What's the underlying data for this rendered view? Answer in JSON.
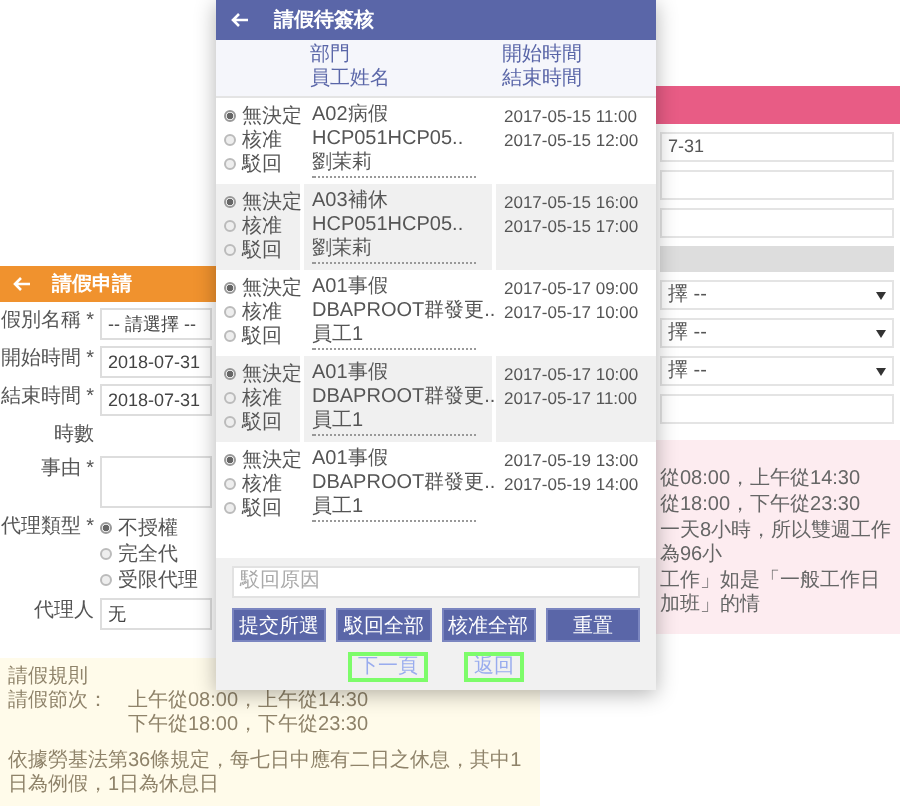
{
  "request_form": {
    "title": "請假申請",
    "fields": [
      {
        "kind": "select",
        "label": "假別名稱 *",
        "value": "-- 請選擇 --"
      },
      {
        "kind": "input",
        "label": "開始時間 *",
        "value": "2018-07-31"
      },
      {
        "kind": "input",
        "label": "結束時間 *",
        "value": "2018-07-31"
      },
      {
        "kind": "text",
        "label": "時數"
      },
      {
        "kind": "textarea",
        "label": "事由 *"
      },
      {
        "kind": "radio",
        "label": "代理類型 *",
        "options": [
          {
            "label": "不授權",
            "selected": true
          },
          {
            "label": "完全代",
            "selected": false
          },
          {
            "label": "受限代理",
            "selected": false
          }
        ]
      },
      {
        "kind": "input",
        "label": "代理人",
        "value": "无"
      }
    ],
    "rules": {
      "title": "請假規則",
      "label": "請假節次：",
      "lines": [
        "上午從08:00，上午從14:30",
        "下午從18:00，下午從23:30"
      ],
      "note": "依據勞基法第36條規定，每七日中應有二日之休息，其中1日為例假，1日為休息日"
    }
  },
  "approval_list": {
    "title": "請假待簽核",
    "columns": [
      {
        "line1": "部門",
        "line2": "員工姓名"
      },
      {
        "line1": "開始時間",
        "line2": "結束時間"
      }
    ],
    "rows": [
      {
        "options": [
          {
            "label": "無決定",
            "selected": true
          },
          {
            "label": "核准",
            "selected": false
          },
          {
            "label": "駁回",
            "selected": false
          }
        ],
        "leave_type": "A02病假",
        "department": "HCP051HCP05..",
        "employee": "劉茉莉",
        "start": "2017-05-15 11:00",
        "end": "2017-05-15 12:00"
      },
      {
        "options": [
          {
            "label": "無決定",
            "selected": true
          },
          {
            "label": "核准",
            "selected": false
          },
          {
            "label": "駁回",
            "selected": false
          }
        ],
        "leave_type": "A03補休",
        "department": "HCP051HCP05..",
        "employee": "劉茉莉",
        "start": "2017-05-15 16:00",
        "end": "2017-05-15 17:00"
      },
      {
        "options": [
          {
            "label": "無決定",
            "selected": true
          },
          {
            "label": "核准",
            "selected": false
          },
          {
            "label": "駁回",
            "selected": false
          }
        ],
        "leave_type": "A01事假",
        "department": "DBAPROOT群發更..",
        "employee": "員工1",
        "start": "2017-05-17 09:00",
        "end": "2017-05-17 10:00"
      },
      {
        "options": [
          {
            "label": "無決定",
            "selected": true
          },
          {
            "label": "核准",
            "selected": false
          },
          {
            "label": "駁回",
            "selected": false
          }
        ],
        "leave_type": "A01事假",
        "department": "DBAPROOT群發更..",
        "employee": "員工1",
        "start": "2017-05-17 10:00",
        "end": "2017-05-17 11:00"
      },
      {
        "options": [
          {
            "label": "無決定",
            "selected": true
          },
          {
            "label": "核准",
            "selected": false
          },
          {
            "label": "駁回",
            "selected": false
          }
        ],
        "leave_type": "A01事假",
        "department": "DBAPROOT群發更..",
        "employee": "員工1",
        "start": "2017-05-19 13:00",
        "end": "2017-05-19 14:00"
      }
    ],
    "reason": {
      "placeholder": "駁回原因"
    },
    "buttons": [
      "提交所選",
      "駁回全部",
      "核准全部",
      "重置"
    ],
    "links": [
      "下一頁",
      "返回"
    ]
  },
  "other_form": {
    "fields": [
      {
        "kind": "input",
        "value": "7-31"
      },
      {
        "kind": "input"
      },
      {
        "kind": "input"
      },
      {
        "kind": "section"
      },
      {
        "kind": "select",
        "value": "擇 --"
      },
      {
        "kind": "select",
        "value": "擇 --"
      },
      {
        "kind": "select",
        "value": "擇 --"
      },
      {
        "kind": "input"
      }
    ],
    "note_lines": [
      "從08:00，上午從14:30",
      "從18:00，下午從23:30",
      "一天8小時，所以雙週工作為96小",
      "工作」如是「一般工作日加班」的情"
    ]
  }
}
